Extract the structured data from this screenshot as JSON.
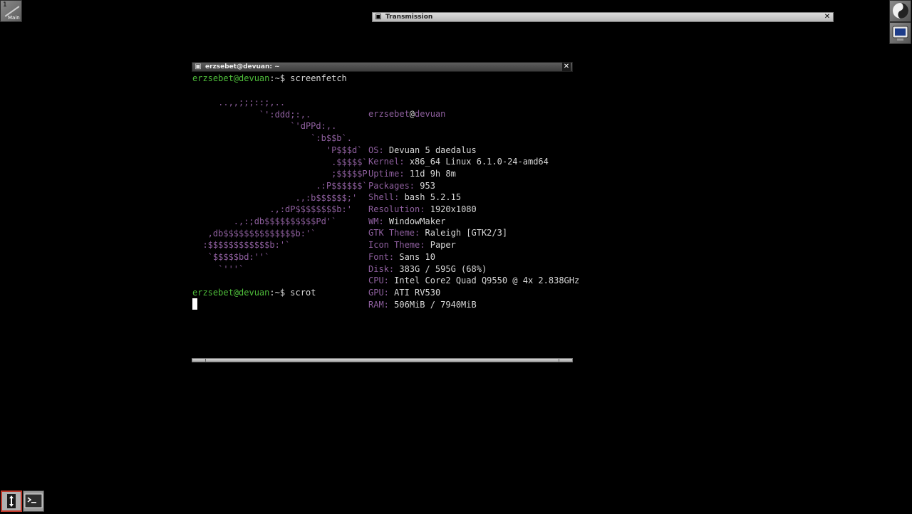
{
  "clip": {
    "number": "1",
    "name": "Main"
  },
  "transmission_window": {
    "title": "Transmission"
  },
  "terminal_window": {
    "title": "erzsebet@devuan: ~"
  },
  "terminal": {
    "prompt_user_host": "erzsebet@devuan",
    "prompt_path": ":~",
    "prompt_symbol": "$",
    "command1": "screenfetch",
    "command2": "scrot",
    "logo_lines": [
      "     ..,,;;;::;,..",
      "             `':ddd;:,.",
      "                   `'dPPd:,.",
      "                       `:b$$b`.",
      "                          'P$$$d`",
      "                           .$$$$$`",
      "                           ;$$$$$P",
      "                        .:P$$$$$$`",
      "                    .,:b$$$$$$;'",
      "               .,:dP$$$$$$$$b:'",
      "        .,:;db$$$$$$$$$$Pd'`",
      "   ,db$$$$$$$$$$$$$$b:'`",
      "  :$$$$$$$$$$$$b:'`",
      "   `$$$$$bd:''`",
      "     `'''`"
    ],
    "info": {
      "user": "erzsebet",
      "at": "@",
      "host": "devuan",
      "rows": [
        {
          "key": "OS:",
          "value": "Devuan 5 daedalus"
        },
        {
          "key": "Kernel:",
          "value": "x86_64 Linux 6.1.0-24-amd64"
        },
        {
          "key": "Uptime:",
          "value": "11d 9h 8m"
        },
        {
          "key": "Packages:",
          "value": "953"
        },
        {
          "key": "Shell:",
          "value": "bash 5.2.15"
        },
        {
          "key": "Resolution:",
          "value": "1920x1080"
        },
        {
          "key": "WM:",
          "value": "WindowMaker"
        },
        {
          "key": "GTK Theme:",
          "value": "Raleigh [GTK2/3]"
        },
        {
          "key": "Icon Theme:",
          "value": "Paper"
        },
        {
          "key": "Font:",
          "value": "Sans 10"
        },
        {
          "key": "Disk:",
          "value": "383G / 595G (68%)"
        },
        {
          "key": "CPU:",
          "value": "Intel Core2 Quad Q9550 @ 4x 2.838GHz"
        },
        {
          "key": "GPU:",
          "value": "ATI RV530"
        },
        {
          "key": "RAM:",
          "value": "506MiB / 7940MiB"
        }
      ]
    }
  },
  "icons": {
    "titlebar_miniaturize": "minimize-icon",
    "titlebar_close": "close-icon",
    "dock_app": "windowmaker-dock-icon",
    "dock_terminal": "terminal-dock-icon",
    "tray_arrows": "resize-arrows-icon",
    "tray_terminal": "terminal-icon"
  },
  "colors": {
    "prompt_green": "#4fbf3b",
    "logo_purple": "#8e5f9e",
    "text_white": "#d8d8d8"
  }
}
